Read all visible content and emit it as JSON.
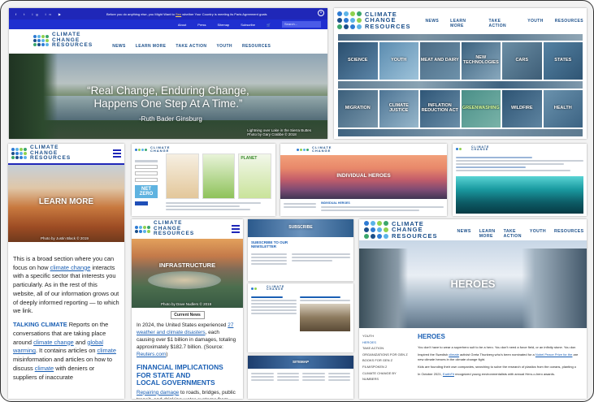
{
  "brand": {
    "line1": "CLIMATE",
    "line2": "CHANGE",
    "line3": "RESOURCES",
    "dot_colors": [
      "#2e7bd3",
      "#5bb3e8",
      "#8fd14f",
      "#3aa66b",
      "#1b4f8a",
      "#2e7bd3",
      "#5bb3e8",
      "#8fd14f",
      "#3aa66b",
      "#1b4f8a",
      "#2e7bd3",
      "#5bb3e8"
    ]
  },
  "nav": [
    "NEWS",
    "LEARN MORE",
    "TAKE ACTION",
    "YOUTH",
    "RESOURCES"
  ],
  "top_bar": {
    "notice_pre": "Before you do anything else, you Might Want to",
    "notice_link": "See",
    "notice_post": "whether Your Country is meeting its Paris Agreement goals",
    "links": [
      "About",
      "Press",
      "Sitemap",
      "Subscribe"
    ],
    "search_placeholder": "Search..."
  },
  "hero": {
    "quote_line1": "“Real Change, Enduring Change,",
    "quote_line2": "Happens One Step At A Time.”",
    "attribution": "-Ruth Bader Ginsburg",
    "credit_line1": "Lightning over Lake in the Sierra Buttes",
    "credit_line2": "Photo by Gary Crabbe © 2018"
  },
  "topics": [
    [
      "SCIENCE",
      "YOUTH",
      "MEAT AND DAIRY",
      "NEW TECHNOLOGIES",
      "CARS",
      "STATES"
    ],
    [
      "MIGRATION",
      "CLIMATE JUSTICE",
      "INFLATION REDUCTION ACT",
      "GREENWASHING",
      "WILDFIRE",
      "HEALTH"
    ]
  ],
  "learn_more": {
    "title": "LEARN MORE",
    "credit": "Photo by Justin Black © 2019",
    "para1_a": "This is a broad section where you can focus on how",
    "para1_link": "climate change",
    "para1_b": "interacts with a specific sector that interests you particularly. As in the rest of this website, all of our information grows out of deeply informed reporting — to which we link.",
    "talking_title": "TALKING CLIMATE",
    "talking_text_a": "Reports on the conversations that are taking place around",
    "talking_link1": "climate change",
    "talking_and": "and",
    "talking_link2": "global warming",
    "talking_text_b": ". It contains articles on",
    "talking_link3": "climate",
    "talking_text_c": "misinformation and articles on how to discuss",
    "talking_link4": "climate",
    "talking_text_d": "with deniers or suppliers of inaccurate"
  },
  "infrastructure": {
    "title": "INFRASTRUCTURE",
    "credit": "Photo by Dave Nudlers © 2019",
    "current_news": "Current News",
    "p1_a": "In 2024, the United States experienced",
    "p1_link": "27 weather and climate disasters",
    "p1_b": ", each causing over $1 billion in damages, totaling approximately $182.7 billion. (Source:",
    "p1_src": "Reuters.com",
    "p1_end": ")",
    "h2_line1": "FINANCIAL IMPLICATIONS FOR STATE AND",
    "h2_line2": "LOCAL GOVERNMENTS",
    "p2_link": "Repairing damage",
    "p2_text": "to roads, bridges, public transit, and drinking water systems from increasingly severe climate effects will cost state and local"
  },
  "heroes": {
    "title": "HEROES",
    "page_title": "HEROES",
    "intro": "You don't have to wear a superhero suit to be a hero. You don't need a force field, or an infinity stone. You don",
    "p2_a": "Inspired the Swedish",
    "p2_link": "climate",
    "p2_b": "activist Greta Thunberg who's been nominated for a",
    "p2_link2": "Nobel Peace Prize for the",
    "p2_c": "are new climate heroes in the climate change fight.",
    "p3": "Kids are founding their own companies, searching to solve the research of plastics from the oceans, planting o",
    "p4_a": "In October 2021,",
    "p4_link": "EarthFit",
    "p4_b": "recognized young environmentalists with annual Hero-o-hero awards.",
    "sidebar": [
      "YOUTH",
      "HEROES",
      "TAKE ACTION",
      "ORGANIZATIONS FOR GEN Z",
      "BOOKS FOR GEN Z",
      "FILM/SPOKEN 2",
      "CLIMATE CHANGE BY NUMBERS"
    ]
  },
  "individual_heroes": {
    "title": "INDIVIDUAL HEROES",
    "section_label": "INDIVIDUAL HEROES"
  },
  "subscribe": {
    "banner": "SUBSCRIBE",
    "heading_line1": "SUBSCRIBE TO OUR",
    "heading_line2": "NEWSLETTER"
  },
  "sitemap": {
    "banner": "SITEMAP"
  },
  "net_zero": {
    "label_line1": "NET",
    "label_line2": "ZERO",
    "planet_label": "PLANET"
  }
}
